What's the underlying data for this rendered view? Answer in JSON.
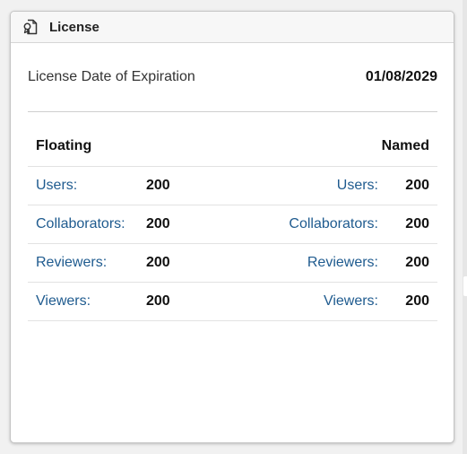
{
  "card": {
    "title": "License",
    "icon": "license-certificate-icon"
  },
  "expiration": {
    "label": "License Date of Expiration",
    "value": "01/08/2029"
  },
  "license_table": {
    "floating_header": "Floating",
    "named_header": "Named",
    "rows": [
      {
        "floating_label": "Users:",
        "floating_value": "200",
        "named_label": "Users:",
        "named_value": "200"
      },
      {
        "floating_label": "Collaborators:",
        "floating_value": "200",
        "named_label": "Collaborators:",
        "named_value": "200"
      },
      {
        "floating_label": "Reviewers:",
        "floating_value": "200",
        "named_label": "Reviewers:",
        "named_value": "200"
      },
      {
        "floating_label": "Viewers:",
        "floating_value": "200",
        "named_label": "Viewers:",
        "named_value": "200"
      }
    ]
  },
  "colors": {
    "link_text": "#1f5b8f",
    "header_bg": "#f7f7f7",
    "page_bg": "#f1f1f1"
  }
}
